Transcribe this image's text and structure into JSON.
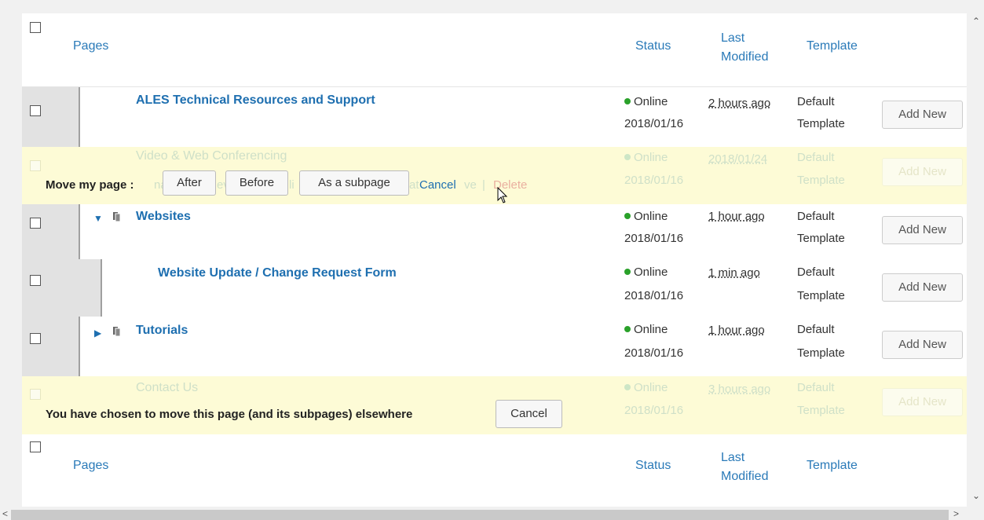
{
  "header": {
    "col_pages": "Pages",
    "col_status": "Status",
    "col_last_modified": "Last Modified",
    "col_template": "Template"
  },
  "footer": {
    "col_pages": "Pages",
    "col_status": "Status",
    "col_last_modified": "Last Modified",
    "col_template": "Template"
  },
  "rows": [
    {
      "title": "ALES Technical Resources and Support",
      "status": "Online",
      "date": "2018/01/16",
      "modified": "2 hours ago",
      "template_line1": "Default",
      "template_line2": "Template",
      "add_label": "Add New"
    },
    {
      "title": "Video & Web Conferencing",
      "status": "Online",
      "date": "2018/01/16",
      "modified": "2018/01/24",
      "template_line1": "Default",
      "template_line2": "Template",
      "add_label": "Add New"
    },
    {
      "title": "Websites",
      "status": "Online",
      "date": "2018/01/16",
      "modified": "1 hour ago",
      "template_line1": "Default",
      "template_line2": "Template",
      "add_label": "Add New"
    },
    {
      "title": "Website Update / Change Request Form",
      "status": "Online",
      "date": "2018/01/16",
      "modified": "1 min ago",
      "template_line1": "Default",
      "template_line2": "Template",
      "add_label": "Add New"
    },
    {
      "title": "Tutorials",
      "status": "Online",
      "date": "2018/01/16",
      "modified": "1 hour ago",
      "template_line1": "Default",
      "template_line2": "Template",
      "add_label": "Add New"
    },
    {
      "title": "Contact Us",
      "status": "Online",
      "date": "2018/01/16",
      "modified": "3 hours ago",
      "template_line1": "Default",
      "template_line2": "Template",
      "add_label": "Add New"
    }
  ],
  "move_bar": {
    "prompt": "Move my page :",
    "after": "After",
    "before": "Before",
    "subpage": "As a subpage",
    "cancel": "Cancel",
    "ghost_left": "na",
    "ghost_mid1": "ev",
    "ghost_mid2": "li",
    "ghost_mid3": "at",
    "ghost_right": "ve",
    "ghost_sep": "|",
    "delete": "Delete"
  },
  "chosen_bar": {
    "message": "You have chosen to move this page (and its subpages) elsewhere",
    "cancel": "Cancel"
  },
  "icons": {
    "expanded": "▼",
    "collapsed": "▶",
    "page": "page-icon"
  },
  "colors": {
    "link": "#1e6fb0",
    "highlight": "#fdfbd6",
    "online": "#2aa12a",
    "delete": "#e8a090"
  }
}
